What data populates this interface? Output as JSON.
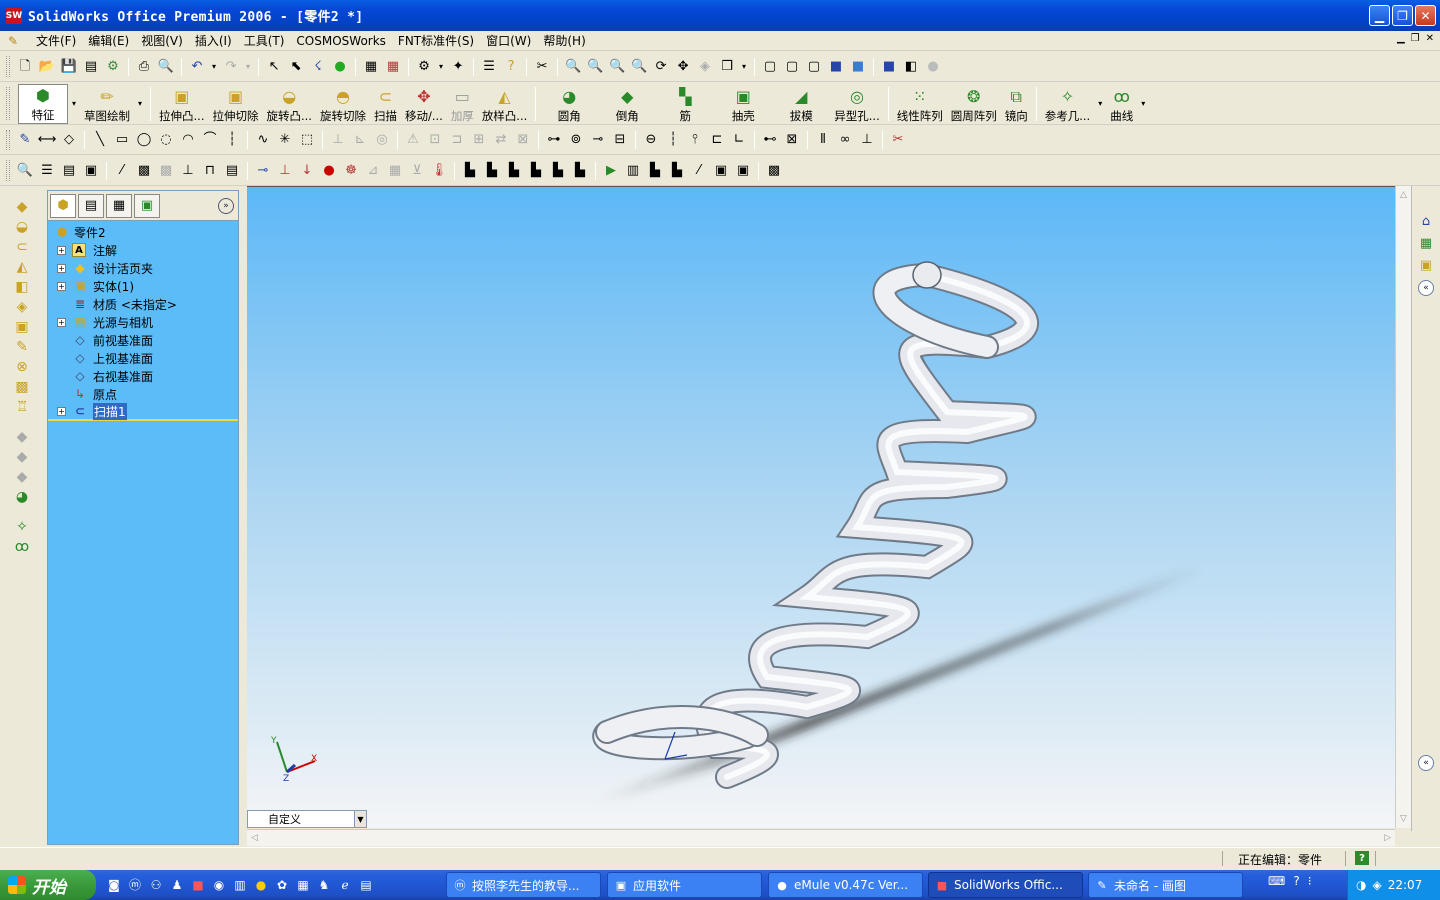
{
  "window": {
    "title": "SolidWorks Office Premium 2006 - [零件2 *]",
    "app_icon": "SW"
  },
  "menu": [
    "文件(F)",
    "编辑(E)",
    "视图(V)",
    "插入(I)",
    "工具(T)",
    "COSMOSWorks",
    "FNT标准件(S)",
    "窗口(W)",
    "帮助(H)"
  ],
  "features": {
    "feature_btn": "特征",
    "sketch_btn": "草图绘制",
    "items": [
      "拉伸凸...",
      "拉伸切除",
      "旋转凸...",
      "旋转切除",
      "扫描",
      "移动/...",
      "加厚",
      "放样凸...",
      "圆角",
      "倒角",
      "筋",
      "抽壳",
      "拔模",
      "异型孔...",
      "线性阵列",
      "圆周阵列",
      "镜向",
      "参考几...",
      "曲线"
    ]
  },
  "tree": {
    "root": "零件2",
    "nodes": [
      {
        "label": "注解",
        "expand": "+",
        "icon": "A"
      },
      {
        "label": "设计活页夹",
        "expand": "+",
        "icon": "◆"
      },
      {
        "label": "实体(1)",
        "expand": "+",
        "icon": "▣"
      },
      {
        "label": "材质 <未指定>",
        "expand": "",
        "icon": "≣"
      },
      {
        "label": "光源与相机",
        "expand": "+",
        "icon": "▤"
      },
      {
        "label": "前视基准面",
        "expand": "",
        "icon": "◇"
      },
      {
        "label": "上视基准面",
        "expand": "",
        "icon": "◇"
      },
      {
        "label": "右视基准面",
        "expand": "",
        "icon": "◇"
      },
      {
        "label": "原点",
        "expand": "",
        "icon": "↳"
      },
      {
        "label": "扫描1",
        "expand": "+",
        "icon": "⊂"
      }
    ]
  },
  "viewport": {
    "view_orientation": "自定义",
    "triad": {
      "x": "X",
      "y": "Y",
      "z": "Z"
    }
  },
  "status": {
    "text": "正在编辑：零件",
    "help": "?"
  },
  "taskbar": {
    "start": "开始",
    "tasks": [
      "按照李先生的教导...",
      "应用软件",
      "eMule v0.47c Ver...",
      "SolidWorks Offic...",
      "未命名 - 画图"
    ],
    "clock": "22:07"
  },
  "colors": {
    "bg_top": "#5CB8F7",
    "bg_bottom": "#F2F4F6",
    "panel": "#5CBCF8",
    "taskbar": "#245EDC"
  }
}
